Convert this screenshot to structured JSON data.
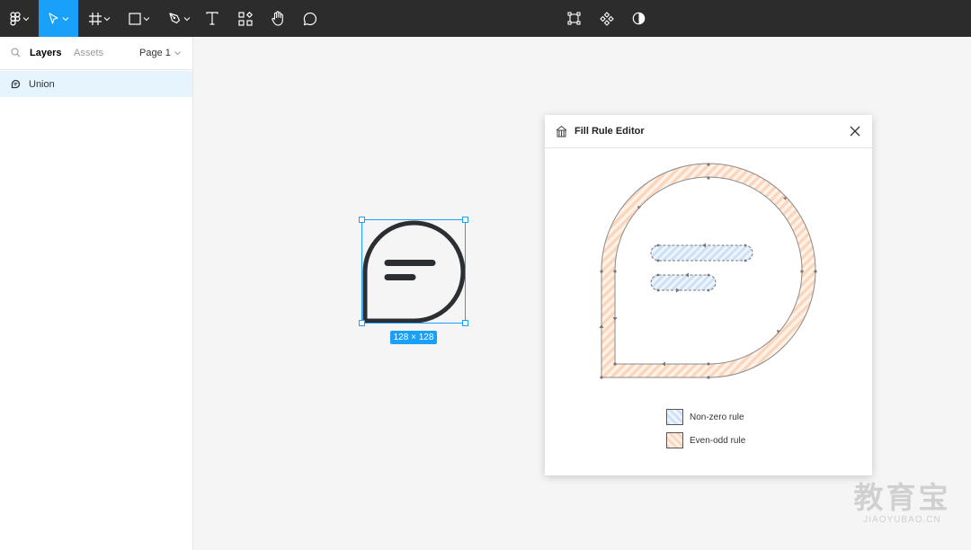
{
  "toolbar": {
    "tools": [
      "figma-menu",
      "move-tool",
      "frame-tool",
      "shape-tool",
      "pen-tool",
      "text-tool",
      "resources-tool",
      "hand-tool",
      "comment-tool"
    ],
    "center_tools": [
      "transform-tool",
      "component-tool",
      "mask-tool"
    ],
    "active_tool": "move-tool",
    "accent": "#18a0fb",
    "bg": "#2c2c2c"
  },
  "left_panel": {
    "tabs": {
      "layers": "Layers",
      "assets": "Assets"
    },
    "page": "Page 1",
    "layers": [
      {
        "name": "Union",
        "icon": "boolean-icon",
        "selected": true
      }
    ]
  },
  "canvas": {
    "selection_size": "128 × 128",
    "icon_stroke": "#2b2e33"
  },
  "dialog": {
    "title": "Fill Rule Editor",
    "legend": [
      {
        "label": "Non-zero rule",
        "color": "#cfe2f7"
      },
      {
        "label": "Even-odd rule",
        "color": "#fcd8c0"
      }
    ]
  },
  "watermark": {
    "cn": "教育宝",
    "en": "JIAOYUBAO.CN"
  }
}
